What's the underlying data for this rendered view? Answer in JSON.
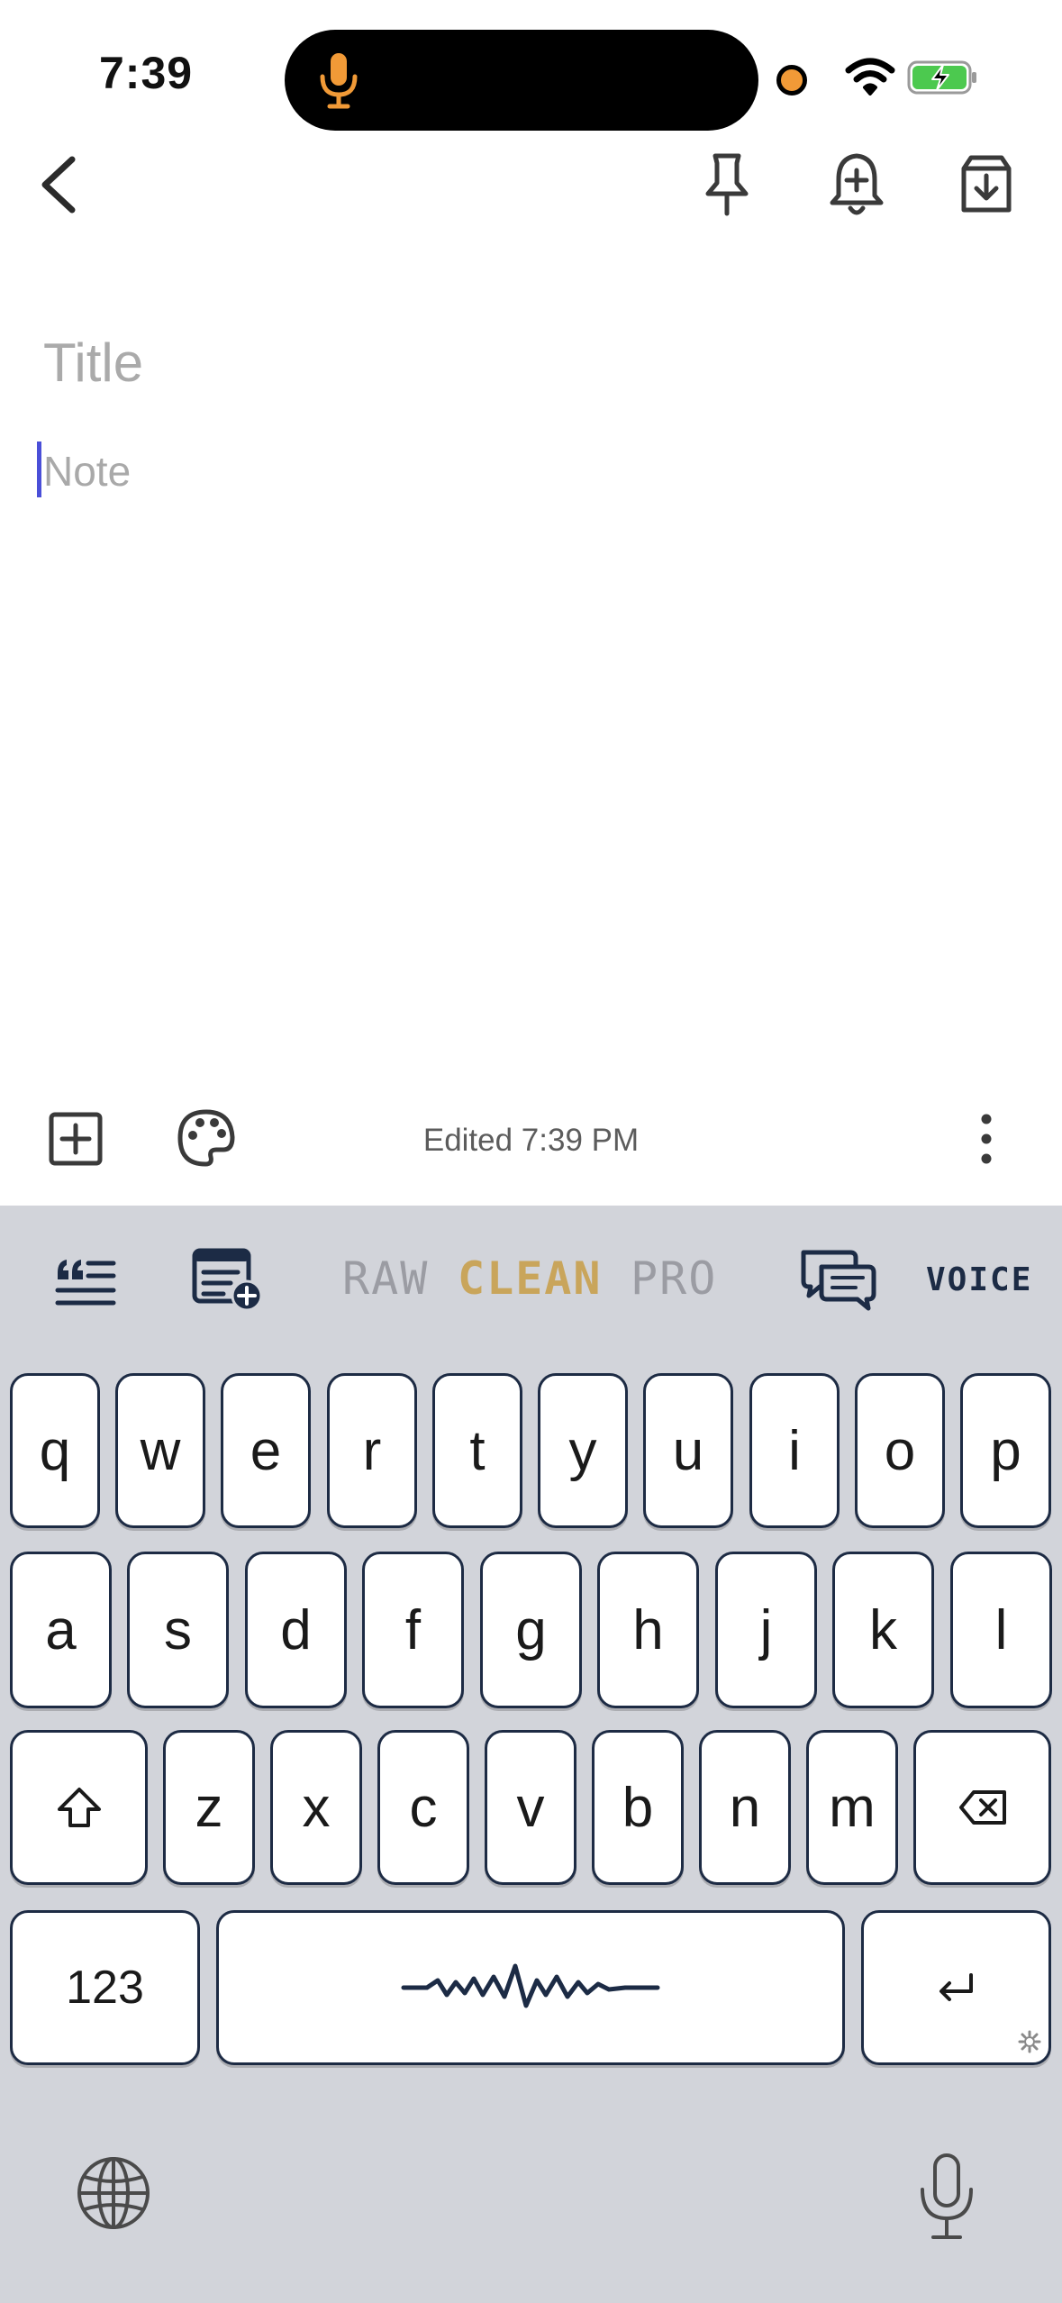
{
  "status_bar": {
    "time": "7:39"
  },
  "editor": {
    "title_placeholder": "Title",
    "note_placeholder": "Note"
  },
  "note_toolbar": {
    "edited_text": "Edited 7:39 PM"
  },
  "keyboard": {
    "modes": {
      "raw": "RAW",
      "clean": "CLEAN",
      "pro": "PRO",
      "active": "CLEAN"
    },
    "voice_label": "VOICE",
    "rows": [
      [
        "q",
        "w",
        "e",
        "r",
        "t",
        "y",
        "u",
        "i",
        "o",
        "p"
      ],
      [
        "a",
        "s",
        "d",
        "f",
        "g",
        "h",
        "j",
        "k",
        "l"
      ],
      [
        "z",
        "x",
        "c",
        "v",
        "b",
        "n",
        "m"
      ]
    ],
    "numbers_key": "123"
  },
  "colors": {
    "accent_caret": "#4a4fd8",
    "mode_active": "#c9a55b",
    "mode_inactive": "#9b9ca3",
    "key_border": "#1d2b44",
    "keyboard_bg": "#d2d4da",
    "mic_orange": "#f19a37"
  }
}
